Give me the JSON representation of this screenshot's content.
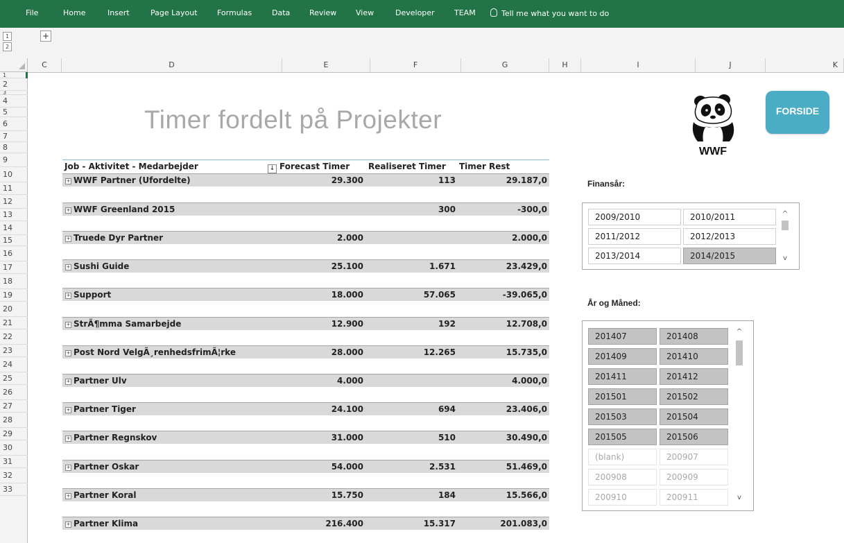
{
  "ribbon": {
    "tabs": [
      "File",
      "Home",
      "Insert",
      "Page Layout",
      "Formulas",
      "Data",
      "Review",
      "View",
      "Developer",
      "TEAM"
    ],
    "tell_me": "Tell me what you want to do"
  },
  "outline": {
    "levels": [
      "1",
      "2"
    ],
    "expand": "+"
  },
  "columns": [
    "C",
    "D",
    "E",
    "F",
    "G",
    "H",
    "I",
    "J",
    "K"
  ],
  "rows": [
    "1",
    "2",
    "3",
    "4",
    "5",
    "6",
    "7",
    "8",
    "9",
    "10",
    "11",
    "12",
    "13",
    "14",
    "15",
    "16",
    "17",
    "18",
    "19",
    "20",
    "21",
    "22",
    "23",
    "24",
    "25",
    "26",
    "27",
    "28",
    "29",
    "30",
    "31",
    "32",
    "33"
  ],
  "title": "Timer fordelt på Projekter",
  "pivot": {
    "headers": {
      "label": "Job - Aktivitet - Medarbejder",
      "forecast": "Forecast Timer",
      "realiseret": "Realiseret Timer",
      "rest": "Timer Rest"
    },
    "items": [
      {
        "label": "WWF Partner (Ufordelte)",
        "forecast": "29.300",
        "realiseret": "113",
        "rest": "29.187,0"
      },
      {
        "label": "WWF Greenland 2015",
        "forecast": "",
        "realiseret": "300",
        "rest": "-300,0"
      },
      {
        "label": "Truede Dyr Partner",
        "forecast": "2.000",
        "realiseret": "",
        "rest": "2.000,0"
      },
      {
        "label": "Sushi Guide",
        "forecast": "25.100",
        "realiseret": "1.671",
        "rest": "23.429,0"
      },
      {
        "label": "Support",
        "forecast": "18.000",
        "realiseret": "57.065",
        "rest": "-39.065,0"
      },
      {
        "label": "StrÃ¶mma Samarbejde",
        "forecast": "12.900",
        "realiseret": "192",
        "rest": "12.708,0"
      },
      {
        "label": "Post Nord VelgÃ¸renhedsfrimÃ¦rke",
        "forecast": "28.000",
        "realiseret": "12.265",
        "rest": "15.735,0"
      },
      {
        "label": "Partner Ulv",
        "forecast": "4.000",
        "realiseret": "",
        "rest": "4.000,0"
      },
      {
        "label": "Partner Tiger",
        "forecast": "24.100",
        "realiseret": "694",
        "rest": "23.406,0"
      },
      {
        "label": "Partner Regnskov",
        "forecast": "31.000",
        "realiseret": "510",
        "rest": "30.490,0"
      },
      {
        "label": "Partner Oskar",
        "forecast": "54.000",
        "realiseret": "2.531",
        "rest": "51.469,0"
      },
      {
        "label": "Partner Koral",
        "forecast": "15.750",
        "realiseret": "184",
        "rest": "15.566,0"
      },
      {
        "label": "Partner Klima",
        "forecast": "216.400",
        "realiseret": "15.317",
        "rest": "201.083,0"
      }
    ]
  },
  "logo": {
    "text": "WWF"
  },
  "forside_button": "FORSIDE",
  "slicer_finansaar": {
    "label": "Finansår:",
    "items": [
      {
        "text": "2009/2010",
        "state": "normal"
      },
      {
        "text": "2010/2011",
        "state": "normal"
      },
      {
        "text": "2011/2012",
        "state": "normal"
      },
      {
        "text": "2012/2013",
        "state": "normal"
      },
      {
        "text": "2013/2014",
        "state": "normal"
      },
      {
        "text": "2014/2015",
        "state": "selected"
      }
    ]
  },
  "slicer_maaned": {
    "label": "År og Måned:",
    "items": [
      {
        "text": "201407",
        "state": "selected"
      },
      {
        "text": "201408",
        "state": "selected"
      },
      {
        "text": "201409",
        "state": "selected"
      },
      {
        "text": "201410",
        "state": "selected"
      },
      {
        "text": "201411",
        "state": "selected"
      },
      {
        "text": "201412",
        "state": "selected"
      },
      {
        "text": "201501",
        "state": "selected"
      },
      {
        "text": "201502",
        "state": "selected"
      },
      {
        "text": "201503",
        "state": "selected"
      },
      {
        "text": "201504",
        "state": "selected"
      },
      {
        "text": "201505",
        "state": "selected"
      },
      {
        "text": "201506",
        "state": "selected"
      },
      {
        "text": "(blank)",
        "state": "dim"
      },
      {
        "text": "200907",
        "state": "dim"
      },
      {
        "text": "200908",
        "state": "dim"
      },
      {
        "text": "200909",
        "state": "dim"
      },
      {
        "text": "200910",
        "state": "dim"
      },
      {
        "text": "200911",
        "state": "dim"
      }
    ]
  },
  "colors": {
    "ribbon": "#227447",
    "forside": "#4bacc6",
    "title": "#a8a8a8",
    "band": "#d9d9d9"
  },
  "icons": [
    "lightbulb-icon",
    "sort-icon",
    "expand-icon",
    "scroll-up-icon",
    "scroll-down-icon",
    "panda-logo-icon"
  ]
}
